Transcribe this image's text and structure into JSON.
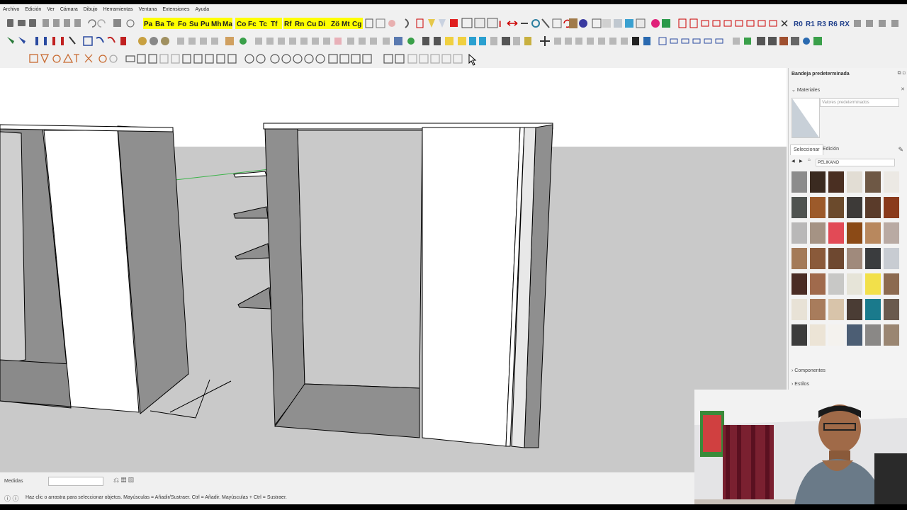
{
  "menu": [
    "Archivo",
    "Edición",
    "Ver",
    "Cámara",
    "Dibujo",
    "Herramientas",
    "Ventana",
    "Extensiones",
    "Ayuda"
  ],
  "toolbar_text": {
    "plugin_labels": [
      "Pa",
      "Ba",
      "Te",
      "Fo",
      "Su",
      "Pu",
      "Mh",
      "Ma",
      "Co",
      "Fc",
      "Tc",
      "Tf",
      "Rf",
      "Rn",
      "Cu",
      "Di",
      "Zö",
      "Mt",
      "Cg"
    ],
    "rotation_labels": [
      "R0",
      "R1",
      "R3",
      "R6",
      "RX"
    ]
  },
  "statusbar": {
    "medidas_label": "Medidas",
    "hint": "Haz clic o arrastra para seleccionar objetos. Mayúsculas = Añadir/Sustraer. Ctrl = Añadir. Mayúsculas + Ctrl = Sustraer."
  },
  "tray": {
    "title": "Bandeja predeterminada",
    "materials_section": "Materiales",
    "material_name_placeholder": "Valores predeterminados",
    "tab_select": "Seleccionar",
    "tab_edit": "Edición",
    "library": "PELIKANO",
    "componentes": "Componentes",
    "estilos": "Estilos",
    "swatch_colors": [
      "#8c8c8c",
      "#3a2a20",
      "#4a2f22",
      "#e2ddd4",
      "#6e5845",
      "#ece9e4",
      "#4f5350",
      "#9c5a2a",
      "#6b4a2c",
      "#3d3a38",
      "#5a3b2a",
      "#8a3a1c",
      "#b9b8b8",
      "#a59384",
      "#e24a56",
      "#8b4a16",
      "#b8885e",
      "#b9aaa3",
      "#a47a58",
      "#8a5a3a",
      "#6e4830",
      "#a08a7c",
      "#3a3c3e",
      "#c8ccd2",
      "#4a2c24",
      "#a06a4c",
      "#c8c8c6",
      "#e6e4d8",
      "#f2e04a",
      "#8c6a50",
      "#e8e2d6",
      "#a87c5c",
      "#d8c4aa",
      "#4a3c34",
      "#1a7a8c",
      "#6a5a4e",
      "#3c3c3c",
      "#ece4d6",
      "#f4f2ee",
      "#4c5e74",
      "#8a8886",
      "#9a8672"
    ]
  },
  "colors": {
    "viewport_bg": "#ffffff",
    "ground": "#c9c9c9",
    "panel_gray": "#8f8f8f",
    "panel_light": "#ffffff",
    "plugin_yellow": "#ffff00",
    "axis_green": "#3cb44a"
  }
}
